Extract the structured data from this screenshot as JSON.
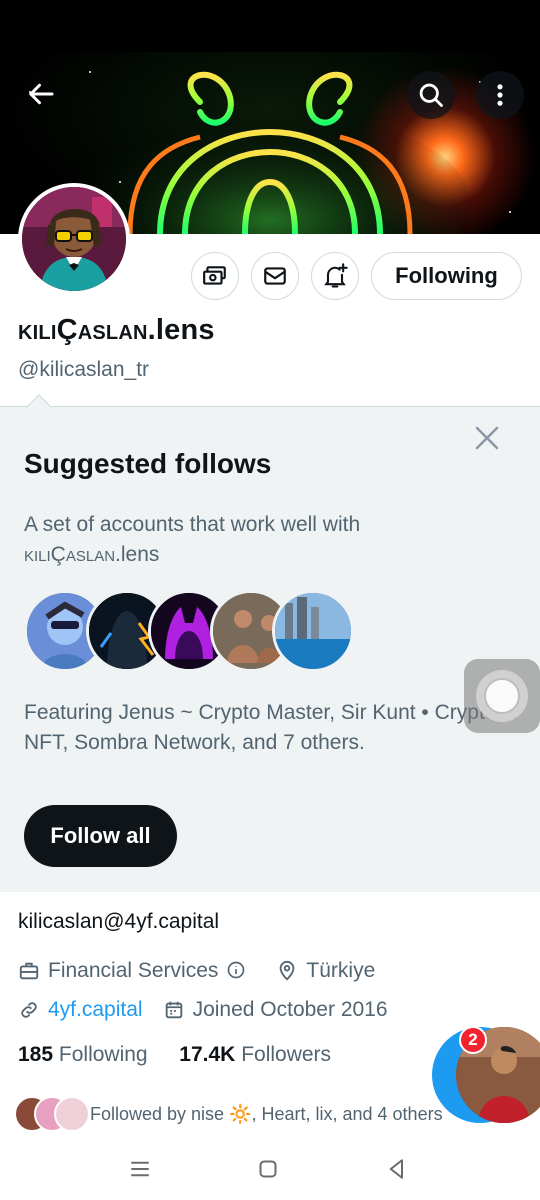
{
  "header": {
    "back_icon": "arrow-left-icon",
    "search_icon": "search-icon",
    "more_icon": "more-vertical-icon"
  },
  "profile": {
    "display_name_smallcaps": "kılıÇaslan",
    "display_name_suffix": ".lens",
    "handle": "@kilicaslan_tr",
    "following_button": "Following",
    "action_icons": [
      "tip-jar-icon",
      "mail-icon",
      "bell-plus-icon"
    ]
  },
  "suggested": {
    "title": "Suggested follows",
    "description_prefix": "A set of accounts that work well with",
    "description_name_smallcaps": "kılıÇaslan",
    "description_name_suffix": ".lens",
    "featuring": "Featuring Jenus ~ Crypto Master, Sir Kunt • Crypto & NFT, Sombra Network, and 7 others.",
    "follow_all": "Follow all",
    "close_icon": "close-icon"
  },
  "bio": {
    "text": "kilicaslan@4yf.capital"
  },
  "meta": {
    "category": "Financial Services",
    "location": "Türkiye",
    "website": "4yf.capital",
    "joined": "Joined October 2016"
  },
  "counts": {
    "following_count": "185",
    "following_label": "Following",
    "followers_count": "17.4K",
    "followers_label": "Followers"
  },
  "followed_by": {
    "text": "Followed by nise 🔆, Heart, lix, and 4 others"
  },
  "fab": {
    "badge_count": "2"
  },
  "colors": {
    "accent": "#1d9bf0",
    "text_primary": "#0f1419",
    "text_secondary": "#536471",
    "panel_bg": "#eff3f4",
    "badge": "#f4212e"
  }
}
